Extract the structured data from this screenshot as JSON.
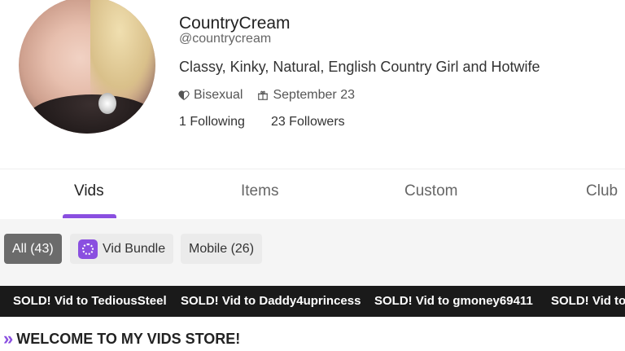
{
  "profile": {
    "display_name": "CountryCream",
    "handle": "@countrycream",
    "bio": "Classy, Kinky, Natural, English Country Girl and Hotwife",
    "orientation": "Bisexual",
    "birthday": "September 23",
    "following": "1 Following",
    "followers": "23 Followers"
  },
  "tabs": [
    {
      "label": "Vids",
      "active": true
    },
    {
      "label": "Items"
    },
    {
      "label": "Custom"
    },
    {
      "label": "Club"
    }
  ],
  "filters": {
    "all": "All (43)",
    "bundle": "Vid Bundle",
    "mobile": "Mobile (26)"
  },
  "ticker": [
    "SOLD! Vid to TediousSteel",
    "SOLD! Vid to Daddy4uprincess",
    "SOLD! Vid to gmoney69411",
    "SOLD! Vid to"
  ],
  "section": {
    "title": "WELCOME TO MY VIDS STORE!"
  },
  "colors": {
    "accent": "#8a4fe0",
    "ticker_bg": "#1a1a1a",
    "chip_active": "#6b6b6b"
  },
  "icons": {
    "orientation": "heart-half-icon",
    "birthday": "gift-icon",
    "bundle": "bundle-icon",
    "section": "double-chevron-right-icon"
  }
}
